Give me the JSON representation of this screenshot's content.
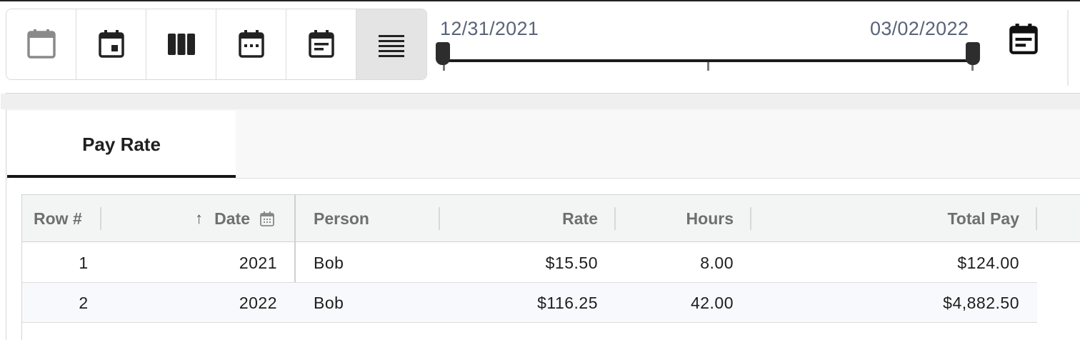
{
  "toolbar": {
    "views": [
      {
        "icon": "calendar-blank-icon",
        "selected": false
      },
      {
        "icon": "calendar-today-icon",
        "selected": false
      },
      {
        "icon": "week-columns-icon",
        "selected": false
      },
      {
        "icon": "calendar-month-icon",
        "selected": false
      },
      {
        "icon": "calendar-agenda-icon",
        "selected": false
      },
      {
        "icon": "list-view-icon",
        "selected": true
      }
    ]
  },
  "date_range": {
    "start": "12/31/2021",
    "end": "03/02/2022"
  },
  "tabs": [
    {
      "label": "Pay Rate",
      "active": true
    }
  ],
  "table": {
    "columns": [
      "Row #",
      "Date",
      "Person",
      "Rate",
      "Hours",
      "Total Pay"
    ],
    "sort": {
      "column": "Date",
      "direction": "ascending"
    },
    "rows": [
      {
        "row": "1",
        "date": "2021",
        "person": "Bob",
        "rate": "$15.50",
        "hours": "8.00",
        "total": "$124.00"
      },
      {
        "row": "2",
        "date": "2022",
        "person": "Bob",
        "rate": "$116.25",
        "hours": "42.00",
        "total": "$4,882.50"
      }
    ]
  },
  "colors": {
    "accent": "#161616",
    "selected_view_bg": "#e4e4e4",
    "date_text": "#5a6478",
    "header_bg": "#f3f5f4"
  }
}
